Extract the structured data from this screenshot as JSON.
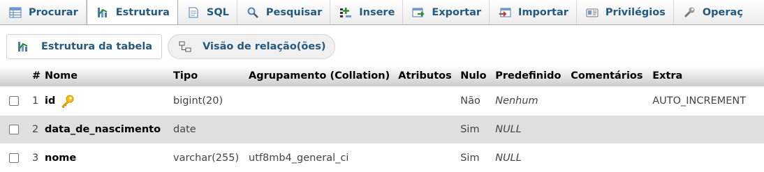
{
  "tabs": [
    {
      "label": "Procurar",
      "icon": "browse-icon"
    },
    {
      "label": "Estrutura",
      "icon": "structure-icon",
      "active": true
    },
    {
      "label": "SQL",
      "icon": "sql-icon"
    },
    {
      "label": "Pesquisar",
      "icon": "search-icon"
    },
    {
      "label": "Insere",
      "icon": "insert-icon"
    },
    {
      "label": "Exportar",
      "icon": "export-icon"
    },
    {
      "label": "Importar",
      "icon": "import-icon"
    },
    {
      "label": "Privilégios",
      "icon": "privileges-icon"
    },
    {
      "label": "Operaç",
      "icon": "operations-icon"
    }
  ],
  "subtabs": {
    "table_structure": "Estrutura da tabela",
    "relation_view": "Visão de relação(ões)"
  },
  "table": {
    "headers": [
      "#",
      "Nome",
      "Tipo",
      "Agrupamento (Collation)",
      "Atributos",
      "Nulo",
      "Predefinido",
      "Comentários",
      "Extra"
    ],
    "rows": [
      {
        "num": "1",
        "name": "id",
        "type": "bigint(20)",
        "collation": "",
        "attributes": "",
        "null": "Não",
        "default": "Nenhum",
        "comments": "",
        "extra": "AUTO_INCREMENT",
        "primary_key": true
      },
      {
        "num": "2",
        "name": "data_de_nascimento",
        "type": "date",
        "collation": "",
        "attributes": "",
        "null": "Sim",
        "default": "NULL",
        "comments": "",
        "extra": ""
      },
      {
        "num": "3",
        "name": "nome",
        "type": "varchar(255)",
        "collation": "utf8mb4_general_ci",
        "attributes": "",
        "null": "Sim",
        "default": "NULL",
        "comments": "",
        "extra": ""
      }
    ]
  },
  "colors": {
    "link": "#235a81",
    "row_alt": "#dfdfdf",
    "key": "#e0a000"
  }
}
